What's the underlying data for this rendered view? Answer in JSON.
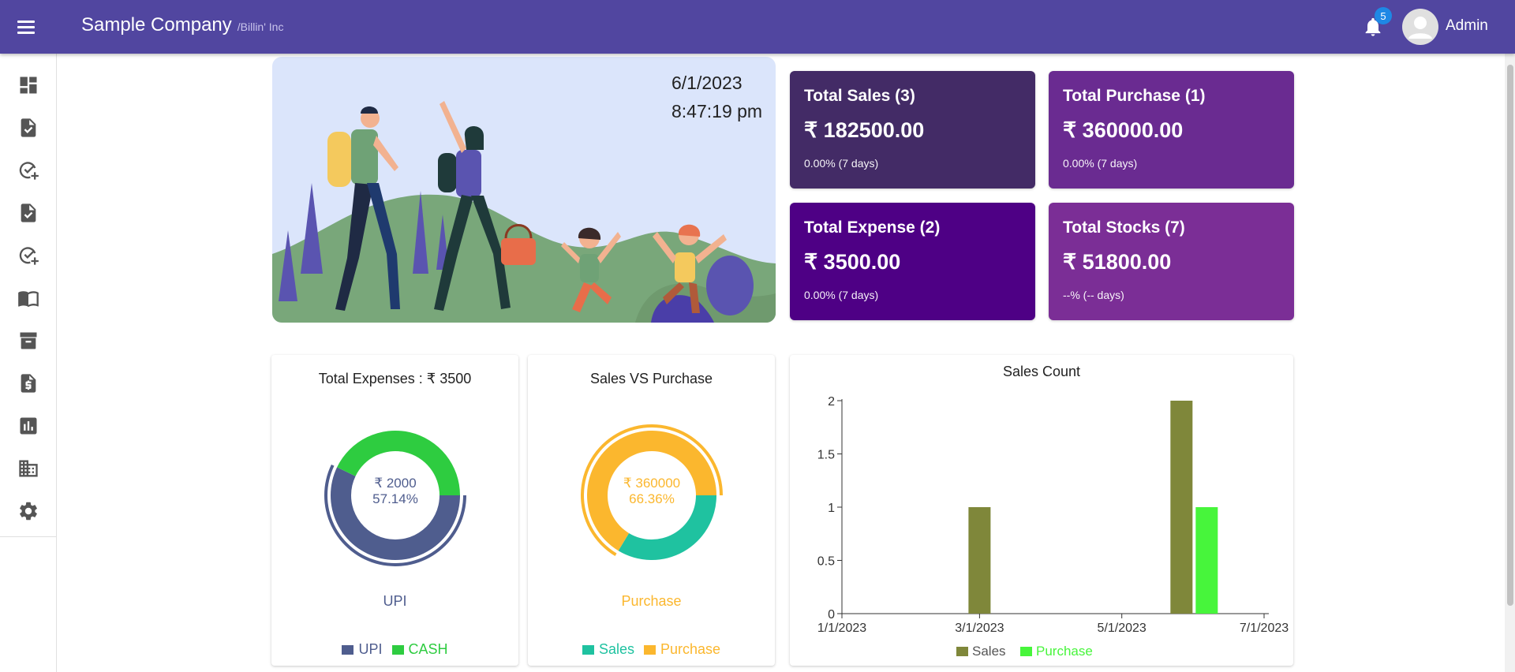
{
  "header": {
    "company": "Sample Company",
    "company_sub": "/Billin' Inc",
    "notifications": "5",
    "user": "Admin"
  },
  "sidebar": {
    "items": [
      {
        "icon": "dashboard-icon"
      },
      {
        "icon": "sales-document-icon"
      },
      {
        "icon": "add-sale-icon"
      },
      {
        "icon": "purchase-document-icon"
      },
      {
        "icon": "add-purchase-icon"
      },
      {
        "icon": "book-icon"
      },
      {
        "icon": "archive-icon"
      },
      {
        "icon": "invoice-dollar-icon"
      },
      {
        "icon": "reports-chart-icon"
      },
      {
        "icon": "business-icon"
      },
      {
        "icon": "settings-gear-icon"
      }
    ]
  },
  "hero": {
    "date": "6/1/2023",
    "time": "8:47:19 pm"
  },
  "stats": [
    {
      "title": "Total Sales (3)",
      "value": "₹ 182500.00",
      "change": "0.00% (7 days)",
      "color": "#432b66"
    },
    {
      "title": "Total Purchase (1)",
      "value": "₹ 360000.00",
      "change": "0.00% (7 days)",
      "color": "#6a2b91"
    },
    {
      "title": "Total Expense (2)",
      "value": "₹ 3500.00",
      "change": "0.00% (7 days)",
      "color": "#4e0085"
    },
    {
      "title": "Total Stocks (7)",
      "value": "₹ 51800.00",
      "change": "--% (-- days)",
      "color": "#7b2e96"
    }
  ],
  "expenses_chart": {
    "title": "Total Expenses : ₹ 3500",
    "center_value": "₹ 2000",
    "center_pct": "57.14%",
    "active_label": "UPI",
    "legend": [
      {
        "name": "UPI",
        "color": "#4f5d8e"
      },
      {
        "name": "CASH",
        "color": "#2ecc40"
      }
    ]
  },
  "sales_purchase_chart": {
    "title": "Sales VS Purchase",
    "center_value": "₹ 360000",
    "center_pct": "66.36%",
    "active_label": "Purchase",
    "legend": [
      {
        "name": "Sales",
        "color": "#1fc2a0"
      },
      {
        "name": "Purchase",
        "color": "#fbb72e"
      }
    ]
  },
  "chart_data": [
    {
      "type": "pie",
      "title": "Total Expenses : ₹ 3500",
      "categories": [
        "UPI",
        "CASH"
      ],
      "values": [
        2000,
        1500
      ],
      "colors": [
        "#4f5d8e",
        "#2ecc40"
      ]
    },
    {
      "type": "pie",
      "title": "Sales VS Purchase",
      "categories": [
        "Sales",
        "Purchase"
      ],
      "values": [
        182500,
        360000
      ],
      "colors": [
        "#1fc2a0",
        "#fbb72e"
      ]
    },
    {
      "type": "bar",
      "title": "Sales Count",
      "xlabel": "",
      "ylabel": "",
      "ylim": [
        0,
        2
      ],
      "xlim": [
        "1/1/2023",
        "7/1/2023"
      ],
      "x_ticks": [
        "1/1/2023",
        "3/1/2023",
        "5/1/2023",
        "7/1/2023"
      ],
      "y_ticks": [
        "0",
        "0.5",
        "1",
        "1.5",
        "2"
      ],
      "series": [
        {
          "name": "Sales",
          "color": "#7f873a",
          "points": [
            {
              "x": "3/1/2023",
              "y": 1
            },
            {
              "x": "6/1/2023",
              "y": 2
            }
          ]
        },
        {
          "name": "Purchase",
          "color": "#47f53b",
          "points": [
            {
              "x": "6/1/2023",
              "y": 1
            }
          ]
        }
      ],
      "legend": "bottom"
    }
  ]
}
